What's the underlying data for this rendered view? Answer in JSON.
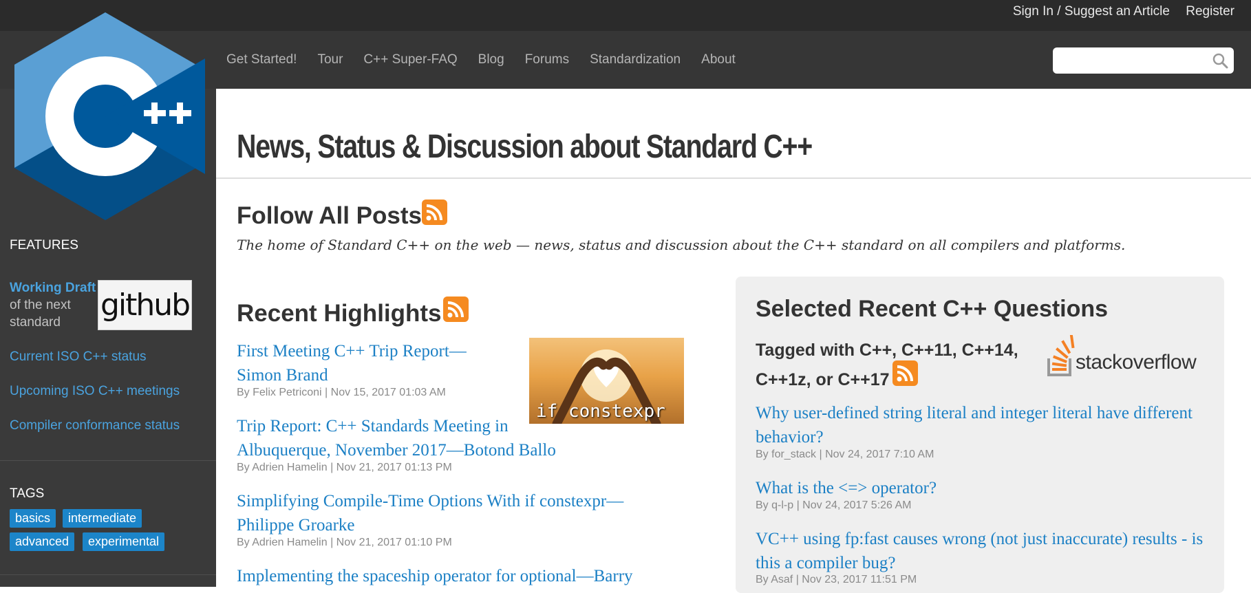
{
  "topbar": {
    "signin_label": "Sign In / Suggest an Article",
    "register_label": "Register"
  },
  "nav": [
    "Get Started!",
    "Tour",
    "C++ Super-FAQ",
    "Blog",
    "Forums",
    "Standardization",
    "About"
  ],
  "search": {
    "placeholder": ""
  },
  "sidebar": {
    "features_heading": "FEATURES",
    "working_draft": {
      "bold": "Working Draft",
      "rest": " of the next standard"
    },
    "github_label": "github",
    "links": [
      "Current ISO C++ status",
      "Upcoming ISO C++ meetings",
      "Compiler conformance status"
    ],
    "tags_heading": "TAGS",
    "tags": [
      "basics",
      "intermediate",
      "advanced",
      "experimental"
    ]
  },
  "main": {
    "title": "News, Status & Discussion about Standard C++",
    "follow_heading": "Follow All Posts",
    "tagline": "The home of Standard C++ on the web — news, status and discussion about the C++ standard on all compilers and platforms.",
    "highlights_heading": "Recent Highlights",
    "thumb_caption": "if constexpr",
    "posts": [
      {
        "title": "First Meeting C++ Trip Report—Simon Brand",
        "meta": "By Felix Petriconi | Nov 15, 2017 01:03 AM"
      },
      {
        "title": "Trip Report: C++ Standards Meeting in Albuquerque, November 2017—Botond Ballo",
        "meta": "By Adrien Hamelin | Nov 21, 2017 01:13 PM"
      },
      {
        "title": "Simplifying Compile-Time Options With if constexpr—Philippe Groarke",
        "meta": "By Adrien Hamelin | Nov 21, 2017 01:10 PM"
      },
      {
        "title": "Implementing the spaceship operator for optional—Barry",
        "meta": ""
      }
    ]
  },
  "questions": {
    "heading": "Selected Recent C++ Questions",
    "tagged": "Tagged with C++, C++11, C++14, C++1z, or C++17",
    "so_logo": "stackoverflow",
    "items": [
      {
        "title": "Why user-defined string literal and integer literal have different behavior?",
        "meta": "By for_stack | Nov 24, 2017 7:10 AM"
      },
      {
        "title": "What is the <=> operator?",
        "meta": "By q-l-p | Nov 24, 2017 5:26 AM"
      },
      {
        "title": "VC++ using fp:fast causes wrong (not just inaccurate) results - is this a compiler bug?",
        "meta": "By Asaf | Nov 23, 2017 11:51 PM"
      }
    ]
  },
  "colors": {
    "link": "#1c80c5",
    "sidebar_link": "#4aa3df",
    "tag_bg": "#1c85c9",
    "rss": "#f58a20",
    "nav_bg": "#363636",
    "sidebar_bg": "#3a3a3a"
  }
}
